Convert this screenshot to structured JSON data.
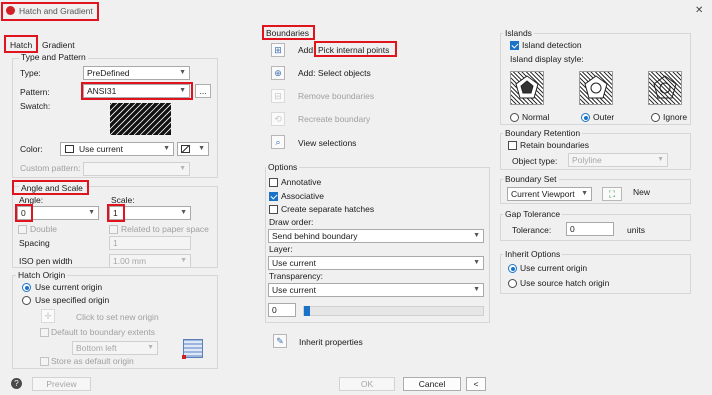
{
  "window": {
    "title": "Hatch and Gradient",
    "close_glyph": "✕"
  },
  "tabs": {
    "hatch": "Hatch",
    "gradient": "Gradient"
  },
  "type_pattern": {
    "group_title": "Type and Pattern",
    "type_label": "Type:",
    "type_value": "PreDefined",
    "pattern_label": "Pattern:",
    "pattern_value": "ANSI31",
    "browse": "...",
    "swatch_label": "Swatch:",
    "color_label": "Color:",
    "color_value": "Use current",
    "custom_label": "Custom pattern:"
  },
  "angle_scale": {
    "group_title": "Angle and Scale",
    "angle_label": "Angle:",
    "angle_value": "0",
    "scale_label": "Scale:",
    "scale_value": "1",
    "double_label": "Double",
    "relative_label": "Related to paper space",
    "spacing_label": "Spacing",
    "spacing_value": "1",
    "iso_label": "ISO pen width",
    "iso_value": "1.00 mm"
  },
  "origin": {
    "group_title": "Hatch Origin",
    "use_current": "Use current origin",
    "specified": "Use specified origin",
    "click_set": "Click to set new origin",
    "default_extents": "Default to boundary extents",
    "position_value": "Bottom left",
    "store_default": "Store as default origin"
  },
  "boundaries": {
    "group_title": "Boundaries",
    "add_prefix": "Add:",
    "pick_points": "Pick internal points",
    "select_objects": "Add: Select objects",
    "remove": "Remove boundaries",
    "recreate": "Recreate boundary",
    "view": "View selections"
  },
  "options": {
    "group_title": "Options",
    "annotative": "Annotative",
    "associative": "Associative",
    "separate": "Create separate hatches",
    "draw_order_label": "Draw order:",
    "draw_order_value": "Send behind boundary",
    "layer_label": "Layer:",
    "layer_value": "Use current",
    "transparency_label": "Transparency:",
    "transparency_value": "Use current",
    "transparency_number": "0",
    "transparency_level": 0,
    "inherit": "Inherit properties"
  },
  "islands": {
    "group_title": "Islands",
    "detection": "Island detection",
    "style_label": "Island display style:",
    "normal": "Normal",
    "outer": "Outer",
    "ignore": "Ignore"
  },
  "retention": {
    "group_title": "Boundary Retention",
    "retain": "Retain boundaries",
    "object_type_label": "Object type:",
    "object_type_value": "Polyline"
  },
  "boundary_set": {
    "group_title": "Boundary Set",
    "value": "Current Viewport",
    "new_label": "New"
  },
  "gap": {
    "group_title": "Gap Tolerance",
    "label": "Tolerance:",
    "value": "0",
    "units": "units"
  },
  "inherit_opts": {
    "group_title": "Inherit Options",
    "current": "Use current origin",
    "source": "Use source hatch origin"
  },
  "footer": {
    "help": "?",
    "preview": "Preview",
    "ok": "OK",
    "cancel": "Cancel",
    "collapse": "<"
  },
  "colors": {
    "highlight": "#e0141e",
    "accent": "#1a73c8"
  }
}
